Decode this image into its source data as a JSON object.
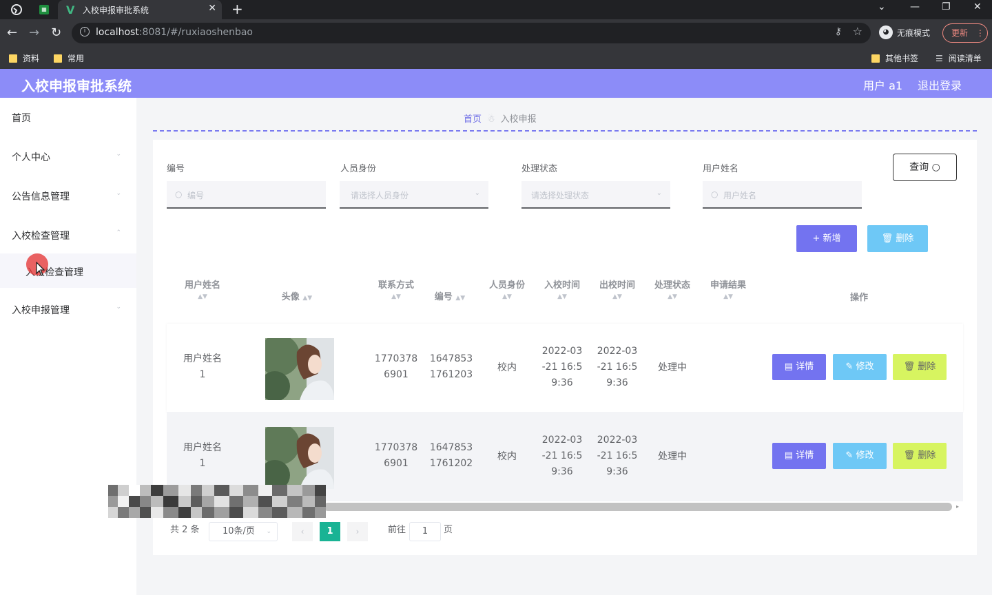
{
  "browser": {
    "tab_title": "入校申报审批系统",
    "tab_close": "✕",
    "new_tab": "+",
    "url_host": "localhost",
    "url_path": ":8081/#/ruxiaoshenbao",
    "incognito_label": "无痕模式",
    "update_label": "更新",
    "bookmarks_left": [
      "资料",
      "常用"
    ],
    "bookmarks_right": [
      "其他书签",
      "阅读清单"
    ]
  },
  "app": {
    "title": "入校申报审批系统",
    "user_label": "用户 a1",
    "logout_label": "退出登录"
  },
  "sidebar": {
    "items": [
      {
        "label": "首页"
      },
      {
        "label": "个人中心"
      },
      {
        "label": "公告信息管理"
      },
      {
        "label": "入校检查管理"
      },
      {
        "label": "入校申报管理"
      }
    ],
    "sub_item": "入校检查管理"
  },
  "breadcrumb": {
    "home": "首页",
    "current": "入校申报"
  },
  "filters": {
    "code": {
      "label": "编号",
      "placeholder": "编号"
    },
    "identity": {
      "label": "人员身份",
      "placeholder": "请选择人员身份"
    },
    "status": {
      "label": "处理状态",
      "placeholder": "请选择处理状态"
    },
    "name": {
      "label": "用户姓名",
      "placeholder": "用户姓名"
    }
  },
  "buttons": {
    "query": "查询",
    "add": "新增",
    "delete": "删除"
  },
  "table": {
    "headers": {
      "name": "用户姓名",
      "avatar": "头像",
      "phone": "联系方式",
      "code": "编号",
      "identity": "人员身份",
      "in_time": "入校时间",
      "out_time": "出校时间",
      "status": "处理状态",
      "result": "申请结果",
      "ops": "操作"
    },
    "rows": [
      {
        "name_l1": "用户姓名",
        "name_l2": "1",
        "phone_l1": "1770378",
        "phone_l2": "6901",
        "code_l1": "1647853",
        "code_l2": "1761203",
        "identity": "校内",
        "in_l1": "2022-03",
        "in_l2": "-21 16:5",
        "in_l3": "9:36",
        "out_l1": "2022-03",
        "out_l2": "-21 16:5",
        "out_l3": "9:36",
        "status": "处理中",
        "result": ""
      },
      {
        "name_l1": "用户姓名",
        "name_l2": "1",
        "phone_l1": "1770378",
        "phone_l2": "6901",
        "code_l1": "1647853",
        "code_l2": "1761202",
        "identity": "校内",
        "in_l1": "2022-03",
        "in_l2": "-21 16:5",
        "in_l3": "9:36",
        "out_l1": "2022-03",
        "out_l2": "-21 16:5",
        "out_l3": "9:36",
        "status": "处理中",
        "result": ""
      }
    ],
    "row_buttons": {
      "detail": "详情",
      "edit": "修改",
      "delete": "删除"
    }
  },
  "pagination": {
    "total": "共 2 条",
    "page_size": "10条/页",
    "current": "1",
    "goto_prefix": "前往",
    "goto_value": "1",
    "goto_suffix": "页"
  },
  "colors": {
    "header": "#8c8cf8",
    "primary": "#7373f0",
    "info": "#6ec8f6",
    "lime": "#d7f460",
    "pager_active": "#19b394"
  }
}
